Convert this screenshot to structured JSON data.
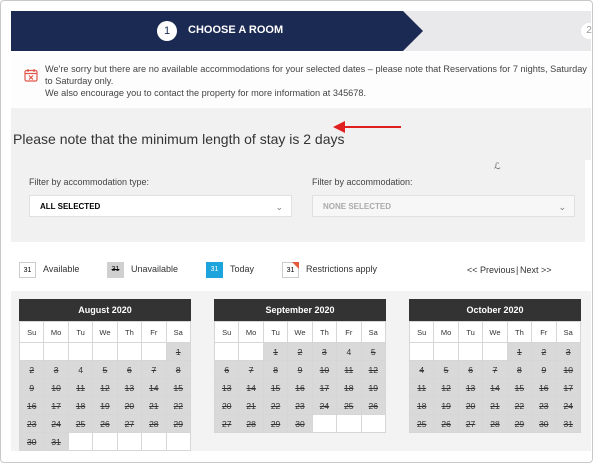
{
  "progress": {
    "step_number": "1",
    "step_label": "CHOOSE A ROOM",
    "next_step_number": "2",
    "active_color": "#1b2a52"
  },
  "notice": {
    "icon": "calendar-x-icon",
    "line1": "We're sorry but there are no available accommodations for your selected dates – please note that Reservations for 7 nights, Saturday to Saturday only.",
    "line2": "We also encourage you to contact the property for more information at 345678."
  },
  "min_stay": {
    "text": "Please note that the minimum length of stay is 2 days",
    "arrow_color": "#e02020"
  },
  "filter": {
    "type_label": "Filter by accommodation type:",
    "type_value": "ALL SELECTED",
    "accommodation_label": "Filter by accommodation:",
    "accommodation_value": "NONE SELECTED",
    "tiny_mark": "ℒ"
  },
  "legend": {
    "available_sample": "31",
    "available_label": "Available",
    "unavailable_sample": "31",
    "unavailable_label": "Unavailable",
    "today_sample": "31",
    "today_label": "Today",
    "today_color": "#1ea4dc",
    "restrictions_sample": "31",
    "restrictions_label": "Restrictions apply",
    "nav_previous": "<< Previous",
    "nav_separator": "|",
    "nav_next": "Next >>"
  },
  "weekdays": [
    "Su",
    "Mo",
    "Tu",
    "We",
    "Th",
    "Fr",
    "Sa"
  ],
  "calendars": [
    {
      "title": "August 2020",
      "weeks": [
        [
          null,
          null,
          null,
          null,
          null,
          null,
          "~1"
        ],
        [
          "~2",
          "~3",
          "4",
          "~5",
          "~6",
          "~7",
          "~8"
        ],
        [
          "~9",
          "~10",
          "~11",
          "~12",
          "~13",
          "~14",
          "~15"
        ],
        [
          "~16",
          "~17",
          "~18",
          "~19",
          "~20",
          "~21",
          "~22"
        ],
        [
          "~23",
          "~24",
          "~25",
          "~26",
          "~27",
          "~28",
          "~29"
        ],
        [
          "~30",
          "~31",
          null,
          null,
          null,
          null,
          null
        ]
      ]
    },
    {
      "title": "September 2020",
      "weeks": [
        [
          null,
          null,
          "~1",
          "~2",
          "~3",
          "4",
          "~5"
        ],
        [
          "~6",
          "~7",
          "~8",
          "~9",
          "~10",
          "~11",
          "~12"
        ],
        [
          "~13",
          "~14",
          "~15",
          "~16",
          "~17",
          "~18",
          "~19"
        ],
        [
          "~20",
          "~21",
          "~22",
          "~23",
          "~24",
          "~25",
          "~26"
        ],
        [
          "~27",
          "~28",
          "~29",
          "~30",
          null,
          null,
          null
        ]
      ]
    },
    {
      "title": "October 2020",
      "weeks": [
        [
          null,
          null,
          null,
          null,
          "~1",
          "~2",
          "~3"
        ],
        [
          "~4",
          "~5",
          "~6",
          "~7",
          "~8",
          "~9",
          "~10"
        ],
        [
          "~11",
          "~12",
          "~13",
          "~14",
          "~15",
          "~16",
          "~17"
        ],
        [
          "~18",
          "~19",
          "~20",
          "~21",
          "~22",
          "~23",
          "~24"
        ],
        [
          "~25",
          "~26",
          "~27",
          "~28",
          "~29",
          "~30",
          "~31"
        ]
      ]
    }
  ]
}
